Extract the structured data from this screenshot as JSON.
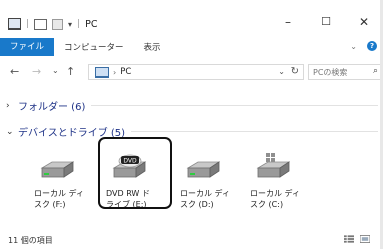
{
  "window": {
    "title": "PC",
    "minimize_glyph": "–",
    "maximize_glyph": "☐",
    "close_glyph": "✕"
  },
  "ribbon": {
    "tabs": [
      "ファイル",
      "コンピューター",
      "表示"
    ],
    "expand_glyph": "⌄",
    "help_glyph": "?"
  },
  "nav": {
    "back": "←",
    "forward": "→",
    "recent": "⌄",
    "up": "↑",
    "address_separator": "›",
    "address_text": "PC",
    "dropdown": "⌄",
    "refresh": "↻",
    "search_placeholder": "PCの検索",
    "search_icon": "⌕"
  },
  "groups": {
    "folders": {
      "chevron": "›",
      "title": "フォルダー (6)"
    },
    "devices": {
      "chevron": "⌄",
      "title": "デバイスとドライブ (5)"
    }
  },
  "drives": [
    {
      "line1": "ローカル ディ",
      "line2": "スク (F:)",
      "icon": "hard-drive-icon"
    },
    {
      "line1": "DVD RW ド",
      "line2": "ライブ (E:)",
      "icon": "dvd-drive-icon",
      "badge": "DVD"
    },
    {
      "line1": "ローカル ディ",
      "line2": "スク (D:)",
      "icon": "hard-drive-icon"
    },
    {
      "line1": "ローカル ディ",
      "line2": "スク (C:)",
      "icon": "windows-drive-icon"
    }
  ],
  "status": {
    "items_count": "11 個の項目"
  },
  "colors": {
    "accent": "#1979ca",
    "group_title": "#1e3287"
  }
}
